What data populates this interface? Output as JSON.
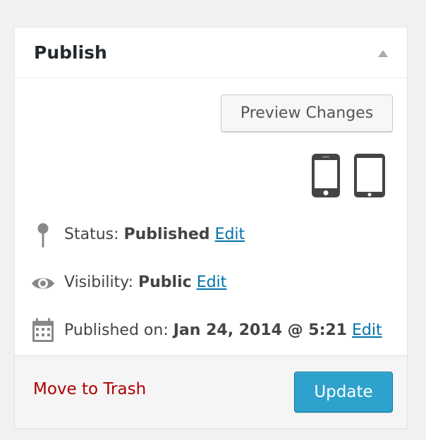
{
  "publish_box": {
    "title": "Publish",
    "toggle_icon": "triangle-up-icon",
    "preview_button_label": "Preview Changes",
    "devices": [
      {
        "name": "phone",
        "icon": "mobile-phone-icon"
      },
      {
        "name": "tablet",
        "icon": "tablet-icon"
      }
    ],
    "status": {
      "icon": "pin-icon",
      "label": "Status:",
      "value": "Published",
      "edit_label": "Edit"
    },
    "visibility": {
      "icon": "eye-icon",
      "label": "Visibility:",
      "value": "Public",
      "edit_label": "Edit"
    },
    "published_on": {
      "icon": "calendar-icon",
      "label": "Published on:",
      "value": "Jan 24, 2014 @ 5:21",
      "edit_label": "Edit"
    },
    "trash_label": "Move to Trash",
    "update_label": "Update"
  },
  "colors": {
    "page_background": "#f1f1f1",
    "link": "#0073aa",
    "trash": "#aa0000",
    "primary_button": "#2ea2cc",
    "icon_gray": "#888888",
    "device_dark": "#444444"
  }
}
